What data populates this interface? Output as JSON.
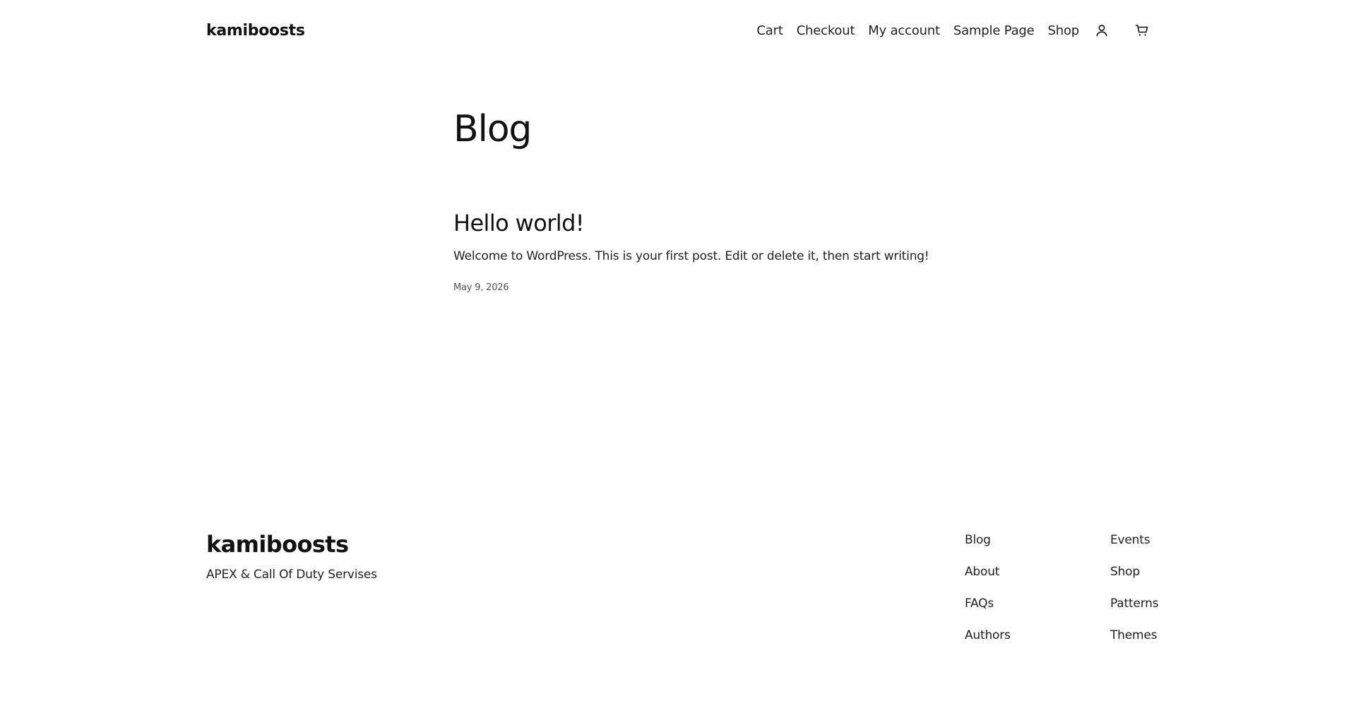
{
  "header": {
    "site_title": "kamiboosts",
    "nav": {
      "cart": "Cart",
      "checkout": "Checkout",
      "my_account": "My account",
      "sample_page": "Sample Page",
      "shop": "Shop"
    },
    "icons": {
      "account": "user-icon",
      "cart": "shopping-cart-icon"
    }
  },
  "main": {
    "page_title": "Blog",
    "posts": [
      {
        "title": "Hello world!",
        "excerpt": "Welcome to WordPress. This is your first post. Edit or delete it, then start writing!",
        "date": "May 9, 2026"
      }
    ]
  },
  "footer": {
    "site_title": "kamiboosts",
    "tagline": "APEX & Call Of Duty Servises",
    "links_col1": [
      "Blog",
      "About",
      "FAQs",
      "Authors"
    ],
    "links_col2": [
      "Events",
      "Shop",
      "Patterns",
      "Themes"
    ]
  },
  "colors": {
    "background": "#ffffff",
    "text": "#111111",
    "muted": "#555555"
  }
}
